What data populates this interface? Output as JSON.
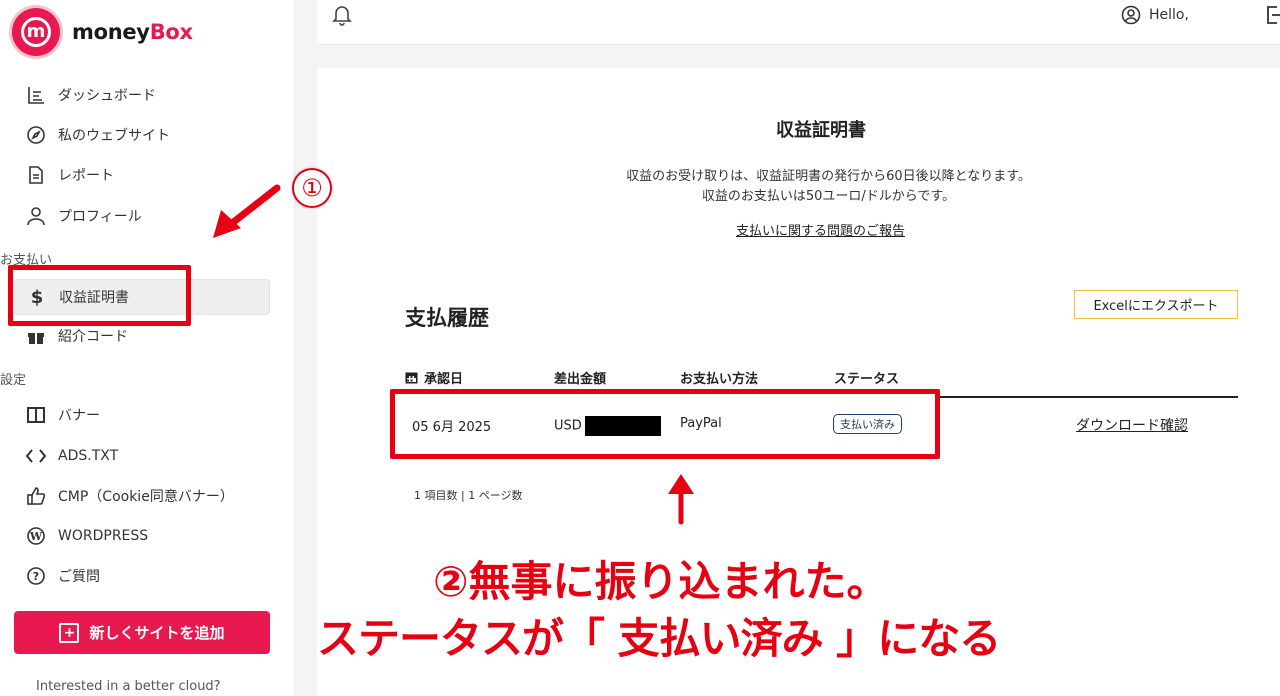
{
  "app": {
    "logo_money": "money",
    "logo_box": "Box",
    "brand_color": "#e8194e"
  },
  "sidebar": {
    "items": [
      {
        "label": "ダッシュボード",
        "icon": "dashboard-icon"
      },
      {
        "label": "私のウェブサイト",
        "icon": "compass-icon"
      },
      {
        "label": "レポート",
        "icon": "document-icon"
      },
      {
        "label": "プロフィール",
        "icon": "user-icon"
      }
    ],
    "section_payment": "お支払い",
    "payment_items": [
      {
        "label": "収益証明書",
        "icon": "dollar-icon",
        "active": true
      },
      {
        "label": "紹介コード",
        "icon": "gift-icon"
      }
    ],
    "section_settings": "設定",
    "settings_items": [
      {
        "label": "バナー",
        "icon": "banner-icon"
      },
      {
        "label": "ADS.TXT",
        "icon": "code-icon"
      },
      {
        "label": "CMP（Cookie同意バナー）",
        "icon": "thumbs-up-icon"
      },
      {
        "label": "WORDPRESS",
        "icon": "wordpress-icon"
      },
      {
        "label": "ご質問",
        "icon": "question-icon"
      }
    ],
    "add_site_label": "新しくサイトを追加",
    "cloud_text": "Interested in a better cloud?"
  },
  "header": {
    "hello": "Hello,"
  },
  "main": {
    "title": "収益証明書",
    "notice_line1": "収益のお受け取りは、収益証明書の発行から60日後以降となります。",
    "notice_line2": "収益のお支払いは50ユーロ/ドルからです。",
    "report_link": "支払いに関する問題のご報告",
    "history_title": "支払履歴",
    "export_label": "Excelにエクスポート",
    "columns": [
      "承認日",
      "差出金額",
      "お支払い方法",
      "ステータス"
    ],
    "rows": [
      {
        "date": "05 6月 2025",
        "amount_prefix": "USD",
        "method": "PayPal",
        "status": "支払い済み",
        "action": "ダウンロード確認"
      }
    ],
    "pagination": "1 項目数 | 1 ページ数"
  },
  "annotations": {
    "step1": "①",
    "step2_line1": "②無事に振り込まれた。",
    "step2_line2": "ステータスが「 支払い済み 」になる",
    "color": "#e60012"
  }
}
